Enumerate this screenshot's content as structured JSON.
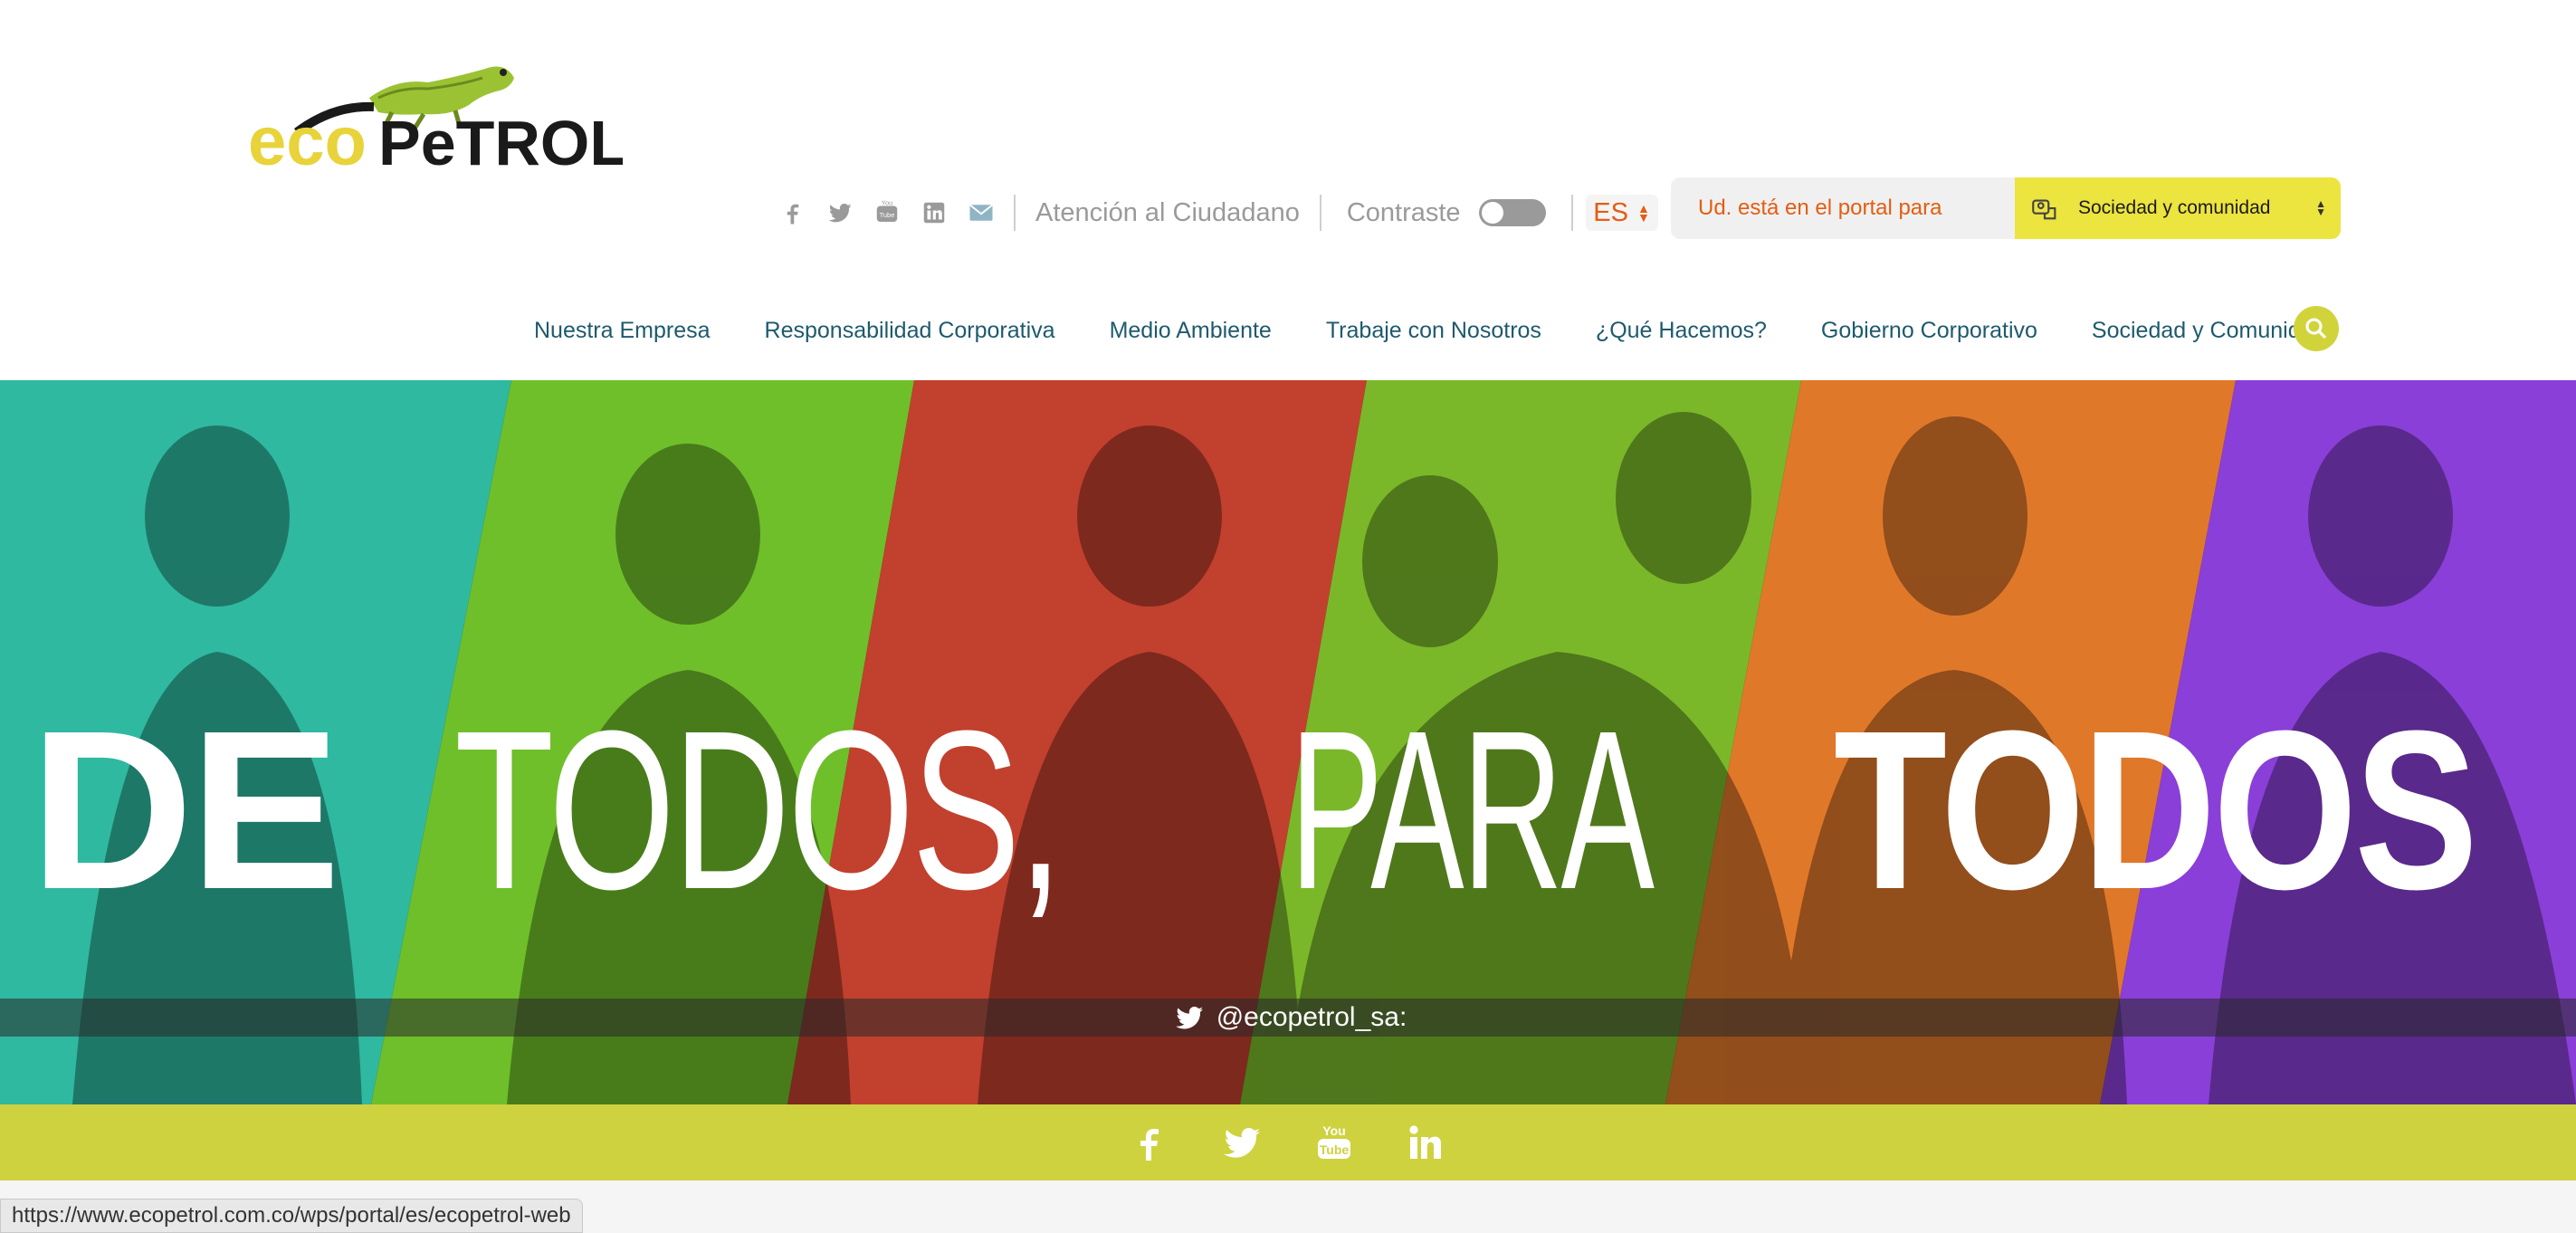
{
  "brand": {
    "logo_text_eco": "eco",
    "logo_text_petrol": "PeTROL"
  },
  "utility": {
    "social_icons": [
      "facebook-icon",
      "twitter-icon",
      "youtube-icon",
      "linkedin-icon",
      "email-icon"
    ],
    "atencion_label": "Atención al Ciudadano",
    "contraste_label": "Contraste",
    "contraste_on": false,
    "language": "ES"
  },
  "portal": {
    "label": "Ud. está en el portal para",
    "selected": "Sociedad y comunidad"
  },
  "nav": {
    "items": [
      "Nuestra Empresa",
      "Responsabilidad Corporativa",
      "Medio Ambiente",
      "Trabaje con Nosotros",
      "¿Qué Hacemos?",
      "Gobierno Corporativo",
      "Sociedad y Comunidad"
    ]
  },
  "hero": {
    "headline_de": "DE",
    "headline_todos1": "TODOS,",
    "headline_para": "PARA",
    "headline_todos2": "TODOS",
    "twitter_handle": "@ecopetrol_sa:",
    "band_colors": [
      "#2fb9a0",
      "#6fbf2a",
      "#c2402e",
      "#7ab82a",
      "#e0782a",
      "#8a3fd8"
    ]
  },
  "footer": {
    "social_icons": [
      "facebook-icon",
      "twitter-icon",
      "youtube-icon",
      "linkedin-icon"
    ]
  },
  "status": {
    "url": "https://www.ecopetrol.com.co/wps/portal/es/ecopetrol-web"
  },
  "colors": {
    "accent_green": "#cfd23f",
    "portal_yellow": "#ece43f",
    "nav_text": "#1e5a6e",
    "orange": "#e35d12"
  }
}
